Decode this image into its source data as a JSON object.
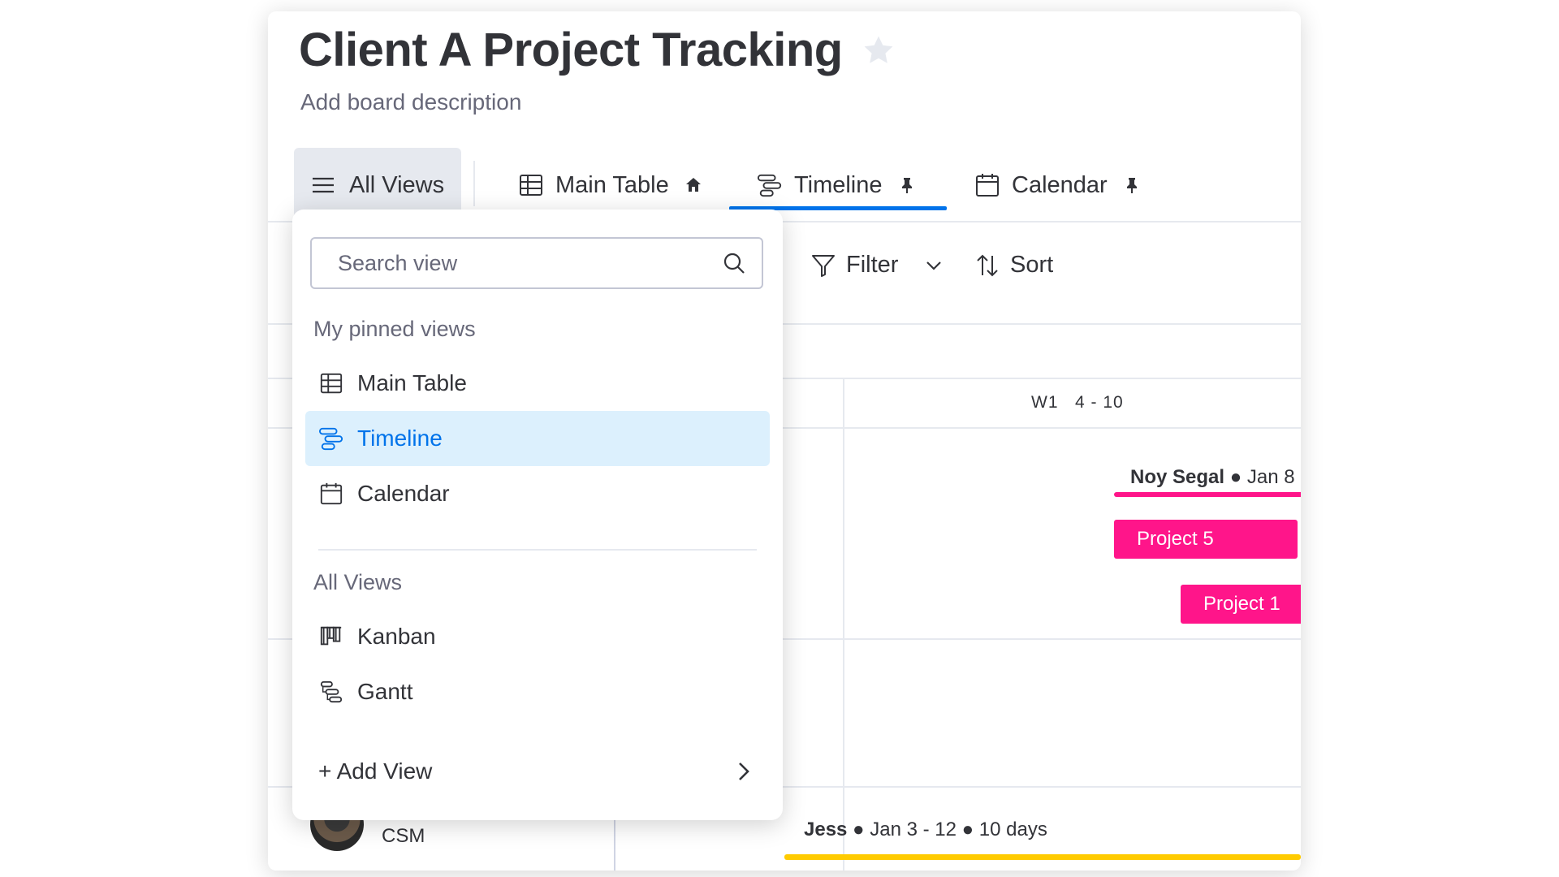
{
  "board": {
    "title": "Client A Project Tracking",
    "description": "Add board description"
  },
  "tabs": {
    "all_views": "All Views",
    "main_table": "Main Table",
    "timeline": "Timeline",
    "calendar": "Calendar"
  },
  "toolbar": {
    "filter": "Filter",
    "sort": "Sort"
  },
  "timeline": {
    "week_label": "W1   4 - 10",
    "milestone_name": "Noy Segal",
    "milestone_date": " ● Jan 8",
    "bars": [
      {
        "label": "Project 5",
        "color": "#ff158a"
      },
      {
        "label": "Project 1",
        "color": "#ff158a"
      }
    ],
    "bottom_row": {
      "role": "CSM",
      "owner": "Jess",
      "dates": " ● Jan 3 - 12 ● 10 days",
      "bar_color": "#ffcb00"
    }
  },
  "dropdown": {
    "search_placeholder": "Search view",
    "pinned_label": "My pinned views",
    "pinned": [
      {
        "label": "Main Table",
        "icon": "table-icon"
      },
      {
        "label": "Timeline",
        "icon": "timeline-icon",
        "active": true
      },
      {
        "label": "Calendar",
        "icon": "calendar-icon"
      }
    ],
    "all_label": "All Views",
    "all": [
      {
        "label": "Kanban",
        "icon": "kanban-icon"
      },
      {
        "label": "Gantt",
        "icon": "gantt-icon"
      }
    ],
    "add_view": "+ Add View"
  },
  "colors": {
    "accent": "#0073ea",
    "active_bg": "#dcf0fd",
    "pink": "#ff158a",
    "yellow": "#ffcb00"
  }
}
